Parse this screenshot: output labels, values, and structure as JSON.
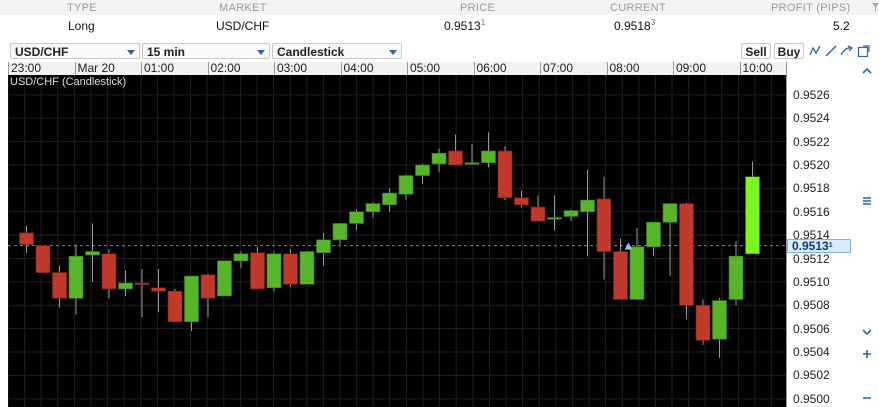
{
  "positions": {
    "headers": {
      "type": "TYPE",
      "market": "MARKET",
      "price": "PRICE",
      "current": "CURRENT",
      "profit": "PROFIT (PIPS)"
    },
    "row": {
      "type": "Long",
      "market": "USD/CHF",
      "price": "0.9513",
      "price_sup": "1",
      "current": "0.9518",
      "current_sup": "3",
      "profit": "5.2"
    }
  },
  "toolbar": {
    "symbol": "USD/CHF",
    "interval": "15 min",
    "chart_type": "Candlestick",
    "sell_label": "Sell",
    "buy_label": "Buy"
  },
  "chart_data": {
    "type": "candlestick",
    "title": "USD/CHF (Candlestick)",
    "time_labels": [
      "23:00",
      "Mar 20",
      "01:00",
      "02:00",
      "03:00",
      "04:00",
      "05:00",
      "06:00",
      "07:00",
      "08:00",
      "09:00",
      "10:00"
    ],
    "y_ticks": [
      "0.9526",
      "0.9524",
      "0.9522",
      "0.9520",
      "0.9518",
      "0.9516",
      "0.9514",
      "0.9512",
      "0.9510",
      "0.9508",
      "0.9506",
      "0.9504",
      "0.9502",
      "0.9500"
    ],
    "ylim": [
      0.94993,
      0.95277
    ],
    "current_price": "0.9513",
    "current_price_sup": "1",
    "current_value": 0.95131,
    "candles": [
      {
        "o": 0.95142,
        "h": 0.95148,
        "l": 0.95125,
        "c": 0.95132
      },
      {
        "o": 0.95131,
        "h": 0.95131,
        "l": 0.9511,
        "c": 0.95108
      },
      {
        "o": 0.95108,
        "h": 0.95114,
        "l": 0.95078,
        "c": 0.95086
      },
      {
        "o": 0.95086,
        "h": 0.95132,
        "l": 0.95072,
        "c": 0.95122
      },
      {
        "o": 0.95123,
        "h": 0.9515,
        "l": 0.951,
        "c": 0.95126
      },
      {
        "o": 0.95124,
        "h": 0.95128,
        "l": 0.95086,
        "c": 0.95094
      },
      {
        "o": 0.95094,
        "h": 0.9511,
        "l": 0.95088,
        "c": 0.95099
      },
      {
        "o": 0.95099,
        "h": 0.95111,
        "l": 0.9507,
        "c": 0.95098
      },
      {
        "o": 0.95095,
        "h": 0.95111,
        "l": 0.95074,
        "c": 0.95092
      },
      {
        "o": 0.95092,
        "h": 0.95094,
        "l": 0.95066,
        "c": 0.95066
      },
      {
        "o": 0.95066,
        "h": 0.95105,
        "l": 0.95058,
        "c": 0.95105
      },
      {
        "o": 0.95106,
        "h": 0.95107,
        "l": 0.9507,
        "c": 0.95086
      },
      {
        "o": 0.95088,
        "h": 0.95117,
        "l": 0.95088,
        "c": 0.95118
      },
      {
        "o": 0.95118,
        "h": 0.95126,
        "l": 0.95112,
        "c": 0.95124
      },
      {
        "o": 0.95125,
        "h": 0.9513,
        "l": 0.95094,
        "c": 0.95094
      },
      {
        "o": 0.95095,
        "h": 0.95126,
        "l": 0.95092,
        "c": 0.95124
      },
      {
        "o": 0.95124,
        "h": 0.95128,
        "l": 0.95096,
        "c": 0.95098
      },
      {
        "o": 0.95098,
        "h": 0.95126,
        "l": 0.95098,
        "c": 0.95126
      },
      {
        "o": 0.95125,
        "h": 0.95142,
        "l": 0.95114,
        "c": 0.95136
      },
      {
        "o": 0.95136,
        "h": 0.9515,
        "l": 0.95132,
        "c": 0.9515
      },
      {
        "o": 0.9515,
        "h": 0.95162,
        "l": 0.95144,
        "c": 0.9516
      },
      {
        "o": 0.9516,
        "h": 0.95168,
        "l": 0.95155,
        "c": 0.95167
      },
      {
        "o": 0.95166,
        "h": 0.9518,
        "l": 0.9516,
        "c": 0.95176
      },
      {
        "o": 0.95175,
        "h": 0.95192,
        "l": 0.9517,
        "c": 0.95191
      },
      {
        "o": 0.95191,
        "h": 0.95201,
        "l": 0.95184,
        "c": 0.952
      },
      {
        "o": 0.95201,
        "h": 0.95214,
        "l": 0.95194,
        "c": 0.9521
      },
      {
        "o": 0.95212,
        "h": 0.95226,
        "l": 0.952,
        "c": 0.952
      },
      {
        "o": 0.95201,
        "h": 0.95218,
        "l": 0.952,
        "c": 0.95202
      },
      {
        "o": 0.95202,
        "h": 0.95228,
        "l": 0.95198,
        "c": 0.95212
      },
      {
        "o": 0.95212,
        "h": 0.95216,
        "l": 0.9517,
        "c": 0.95172
      },
      {
        "o": 0.95172,
        "h": 0.95178,
        "l": 0.95164,
        "c": 0.95166
      },
      {
        "o": 0.95164,
        "h": 0.95174,
        "l": 0.95152,
        "c": 0.95152
      },
      {
        "o": 0.95155,
        "h": 0.95174,
        "l": 0.95144,
        "c": 0.95155
      },
      {
        "o": 0.95156,
        "h": 0.95162,
        "l": 0.95152,
        "c": 0.95161
      },
      {
        "o": 0.9516,
        "h": 0.95196,
        "l": 0.95122,
        "c": 0.9517
      },
      {
        "o": 0.95171,
        "h": 0.9519,
        "l": 0.95102,
        "c": 0.95126
      },
      {
        "o": 0.95126,
        "h": 0.95137,
        "l": 0.95085,
        "c": 0.95085
      },
      {
        "o": 0.95085,
        "h": 0.95146,
        "l": 0.95085,
        "c": 0.9513
      },
      {
        "o": 0.9513,
        "h": 0.95151,
        "l": 0.95122,
        "c": 0.95151
      },
      {
        "o": 0.95151,
        "h": 0.95166,
        "l": 0.95105,
        "c": 0.95167
      },
      {
        "o": 0.95167,
        "h": 0.95168,
        "l": 0.95068,
        "c": 0.9508
      },
      {
        "o": 0.9508,
        "h": 0.95085,
        "l": 0.95046,
        "c": 0.9505
      },
      {
        "o": 0.95051,
        "h": 0.95086,
        "l": 0.95035,
        "c": 0.95084
      },
      {
        "o": 0.95085,
        "h": 0.95135,
        "l": 0.9508,
        "c": 0.95122
      },
      {
        "o": 0.95124,
        "h": 0.95203,
        "l": 0.95124,
        "c": 0.9519
      }
    ]
  }
}
